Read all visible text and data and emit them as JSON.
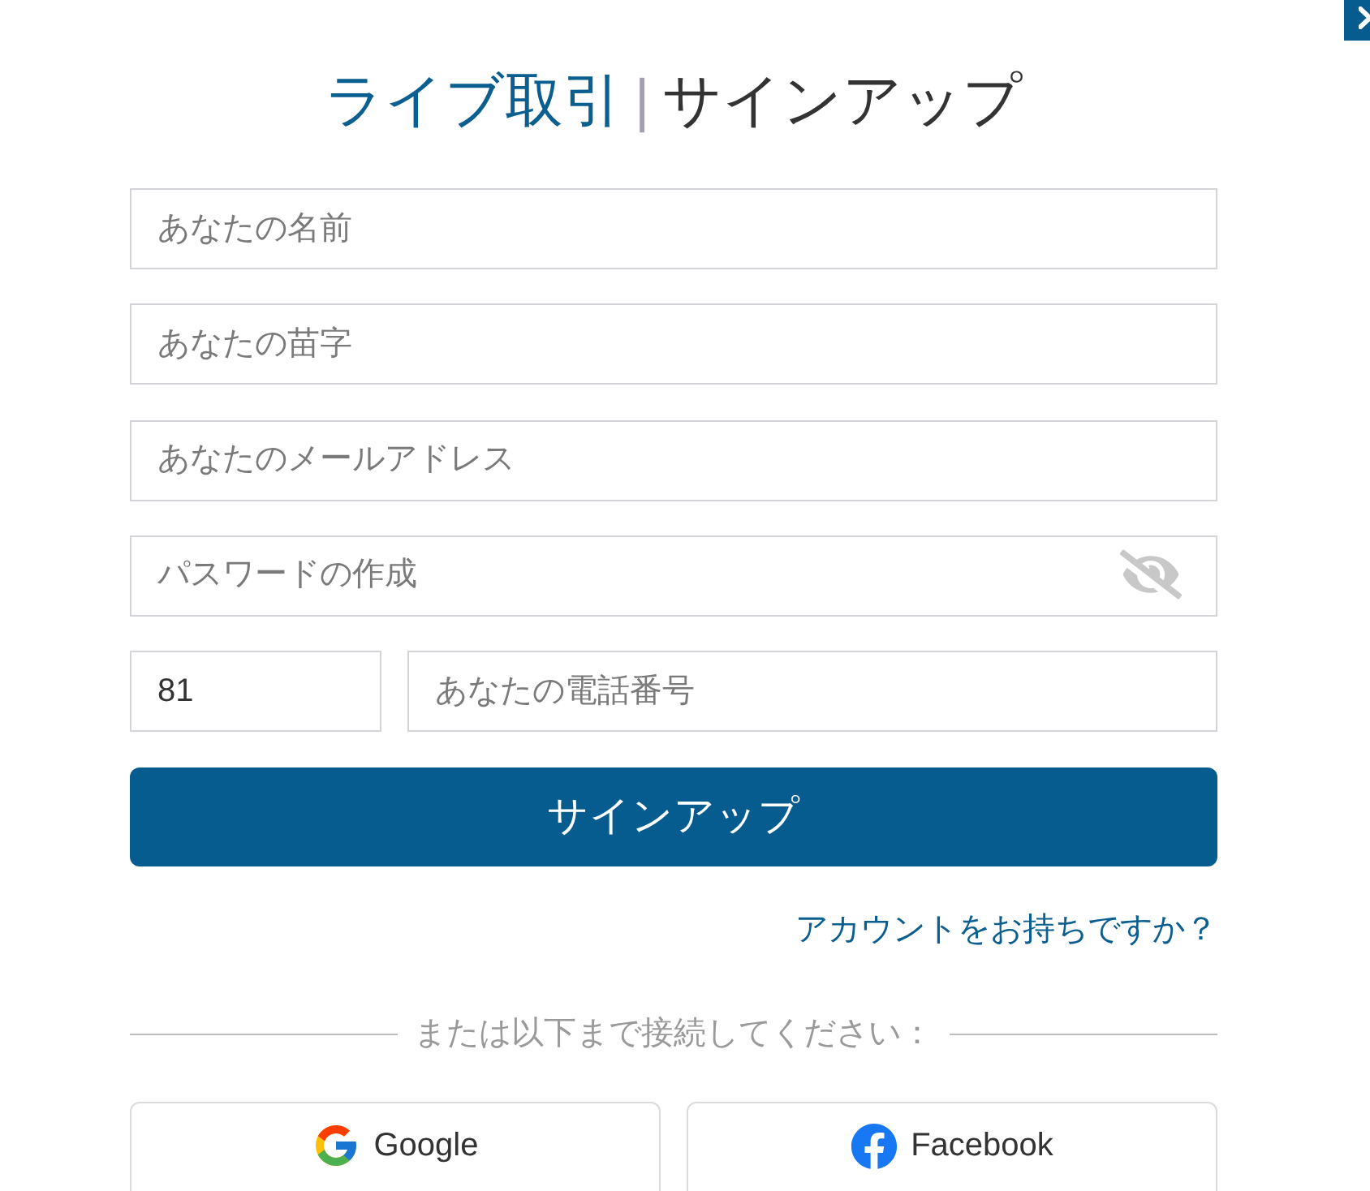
{
  "title": {
    "brand": "ライブ取引",
    "separator": "|",
    "heading": "サインアップ"
  },
  "fields": [
    {
      "kind": "text",
      "placeholder": "あなたの名前"
    },
    {
      "kind": "text",
      "placeholder": "あなたの苗字"
    },
    {
      "kind": "email",
      "placeholder": "あなたのメールアドレス"
    },
    {
      "kind": "password",
      "placeholder": "パスワードの作成",
      "visible": false
    }
  ],
  "phone": {
    "code": "81",
    "placeholder": "あなたの電話番号"
  },
  "submit": "サインアップ",
  "login_link": "アカウントをお持ちですか？",
  "divider_text": "または以下まで接続してください：",
  "social": [
    {
      "kind": "google",
      "label": "Google"
    },
    {
      "kind": "facebook",
      "label": "Facebook"
    }
  ]
}
